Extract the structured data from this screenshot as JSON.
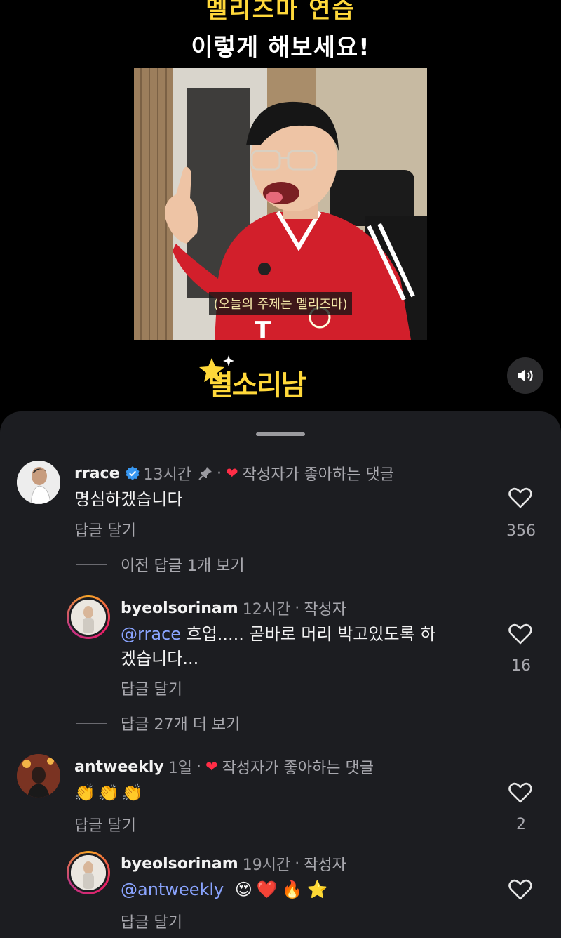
{
  "video": {
    "caption_top_cut": "멜리즈마 연습",
    "caption_title": "이렇게 해보세요!",
    "subtitle": "(오늘의 주제는 멜리즈마)",
    "logo_text": "별소리남",
    "mute_icon": "speaker-icon"
  },
  "comments": [
    {
      "username": "rrace",
      "verified": true,
      "time": "13시간",
      "pinned": true,
      "liked_by_creator": "작성자가 좋아하는 댓글",
      "text": "명심하겠습니다",
      "reply": "답글 달기",
      "likes": "356",
      "view_prev": "이전 답글 1개 보기"
    },
    {
      "username": "byeolsorinam",
      "time": "12시간",
      "author_label": "작성자",
      "mention": "@rrace",
      "text_line1": " 흐업..... 곧바로 머리 박고있도록 하",
      "text_line2": "겠습니다...",
      "reply": "답글 달기",
      "likes": "16",
      "view_more": "답글 27개 더 보기"
    },
    {
      "username": "antweekly",
      "time": "1일",
      "liked_by_creator": "작성자가 좋아하는 댓글",
      "text": "👏👏👏",
      "reply": "답글 달기",
      "likes": "2"
    },
    {
      "username": "byeolsorinam",
      "time": "19시간",
      "author_label": "작성자",
      "mention": "@antweekly",
      "text": "😍❤️🔥⭐",
      "reply": "답글 달기"
    }
  ],
  "separator": "·",
  "colors": {
    "accent_yellow": "#ffd83a",
    "mention_blue": "#8aa4ff",
    "heart_red": "#ff2d46",
    "sheet_bg": "#1c1d21"
  }
}
